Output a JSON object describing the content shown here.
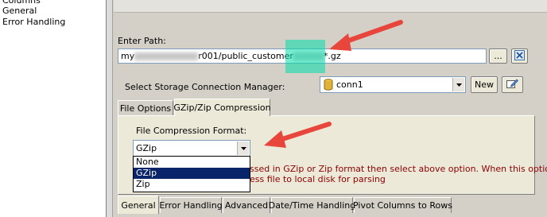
{
  "nav": {
    "items": [
      "Columns",
      "General",
      "Error Handling"
    ]
  },
  "path": {
    "label": "Enter Path:",
    "prefix": "my",
    "middle": "r001/public_customer",
    "suffix": "*.gz",
    "browse_label": "...",
    "clear_icon": "clear-icon"
  },
  "storage": {
    "label": "Select Storage Connection Manager:",
    "value": "conn1",
    "new_label": "New",
    "edit_icon": "edit-icon"
  },
  "tabs": {
    "items": [
      "File Options",
      "GZip/Zip Compression"
    ],
    "active": "GZip/Zip Compression"
  },
  "compression": {
    "label": "File Compression Format:",
    "selected": "GZip",
    "options": [
      "None",
      "GZip",
      "Zip"
    ],
    "note_line1": "ssed in GZip or Zip format then select above option. When this option is",
    "note_line2": "ess file to local disk for parsing"
  },
  "bottom_tabs": [
    "General",
    "Error Handling",
    "Advanced",
    "Date/Time Handling",
    "Pivot Columns to Rows"
  ],
  "colors": {
    "arrow": "#e8453c",
    "highlight": "#00dcaa",
    "selection": "#0a246a",
    "note": "#8b0000"
  }
}
